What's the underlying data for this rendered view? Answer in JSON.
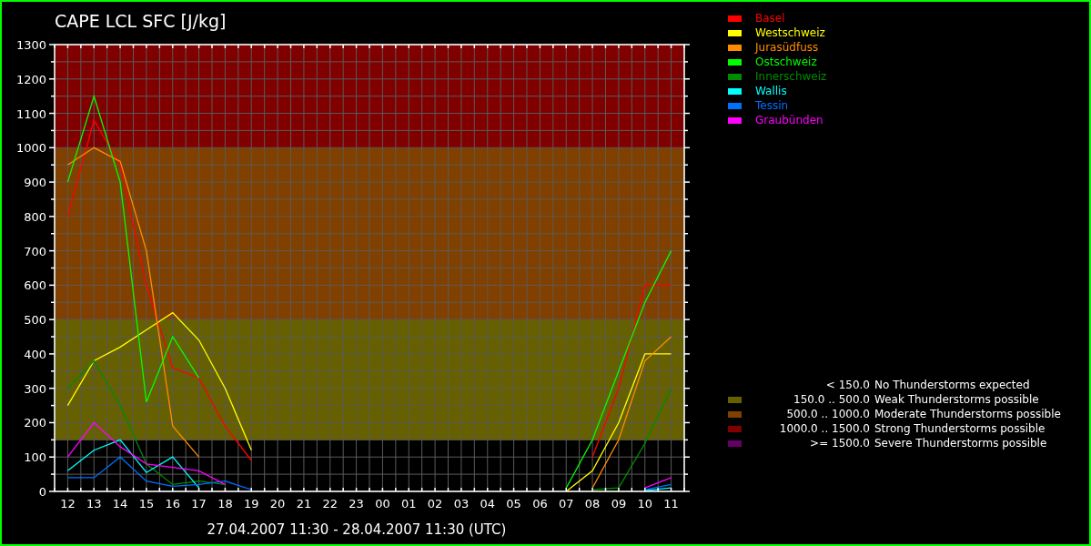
{
  "chart": {
    "chart_data": {
      "type": "line",
      "title": "CAPE LCL SFC [J/kg]",
      "xlabel": "27.04.2007 11:30 - 28.04.2007 11:30  (UTC)",
      "categories": [
        "12",
        "13",
        "14",
        "15",
        "16",
        "17",
        "18",
        "19",
        "20",
        "21",
        "22",
        "23",
        "00",
        "01",
        "02",
        "03",
        "04",
        "05",
        "06",
        "07",
        "08",
        "09",
        "10",
        "11"
      ],
      "ylim": [
        0,
        1300
      ],
      "yticks": [
        0,
        100,
        200,
        300,
        400,
        500,
        600,
        700,
        800,
        900,
        1000,
        1100,
        1200,
        1300
      ],
      "series": [
        {
          "name": "Basel",
          "color": "#ff0000",
          "values": [
            800,
            1080,
            950,
            600,
            360,
            330,
            190,
            90,
            null,
            null,
            null,
            null,
            null,
            null,
            null,
            null,
            null,
            null,
            null,
            null,
            100,
            300,
            600,
            600
          ]
        },
        {
          "name": "Westschweiz",
          "color": "#ffff00",
          "values": [
            250,
            380,
            420,
            470,
            520,
            440,
            300,
            120,
            null,
            null,
            null,
            null,
            null,
            null,
            null,
            null,
            null,
            null,
            null,
            0,
            60,
            200,
            400,
            400
          ]
        },
        {
          "name": "Jurasüdfuss",
          "color": "#ff8c00",
          "values": [
            950,
            1000,
            960,
            700,
            190,
            100,
            null,
            null,
            null,
            null,
            null,
            null,
            null,
            null,
            null,
            null,
            null,
            null,
            null,
            null,
            10,
            150,
            380,
            450
          ]
        },
        {
          "name": "Ostschweiz",
          "color": "#00ff00",
          "values": [
            900,
            1150,
            900,
            260,
            450,
            330,
            null,
            null,
            null,
            null,
            null,
            null,
            null,
            null,
            null,
            null,
            null,
            null,
            null,
            10,
            150,
            350,
            550,
            700
          ]
        },
        {
          "name": "Innerschweiz",
          "color": "#008c00",
          "values": [
            300,
            380,
            250,
            80,
            20,
            30,
            20,
            null,
            null,
            null,
            null,
            null,
            null,
            null,
            null,
            null,
            null,
            null,
            null,
            null,
            5,
            10,
            140,
            300
          ]
        },
        {
          "name": "Wallis",
          "color": "#00ffff",
          "values": [
            60,
            120,
            150,
            55,
            100,
            10,
            null,
            null,
            null,
            null,
            null,
            null,
            null,
            null,
            null,
            null,
            null,
            null,
            null,
            null,
            null,
            null,
            2,
            10
          ]
        },
        {
          "name": "Tessin",
          "color": "#0070ff",
          "values": [
            40,
            40,
            100,
            30,
            15,
            20,
            30,
            5,
            null,
            null,
            null,
            null,
            null,
            null,
            null,
            null,
            null,
            null,
            null,
            null,
            null,
            null,
            5,
            20
          ]
        },
        {
          "name": "Graubünden",
          "color": "#ff00ff",
          "values": [
            100,
            200,
            130,
            80,
            70,
            60,
            20,
            null,
            null,
            null,
            null,
            null,
            null,
            null,
            null,
            null,
            null,
            null,
            null,
            null,
            null,
            null,
            10,
            40
          ]
        }
      ],
      "grid": true,
      "bands": [
        {
          "axis": "y",
          "from": 150,
          "to": 500,
          "color": "#666000"
        },
        {
          "axis": "y",
          "from": 500,
          "to": 1000,
          "color": "#804000"
        },
        {
          "axis": "y",
          "from": 1000,
          "to": 1300,
          "color": "#800000"
        }
      ]
    }
  },
  "thresholds": [
    {
      "range": "< 150.0",
      "text": "No Thunderstorms expected"
    },
    {
      "range": "150.0 .. 500.0",
      "text": "Weak Thunderstorms possible",
      "color": "#666000"
    },
    {
      "range": "500.0 .. 1000.0",
      "text": "Moderate Thunderstorms possible",
      "color": "#804000"
    },
    {
      "range": "1000.0 .. 1500.0",
      "text": "Strong Thunderstorms possible",
      "color": "#800000"
    },
    {
      "range": ">= 1500.0",
      "text": "Severe Thunderstorms possible",
      "color": "#660066"
    }
  ]
}
